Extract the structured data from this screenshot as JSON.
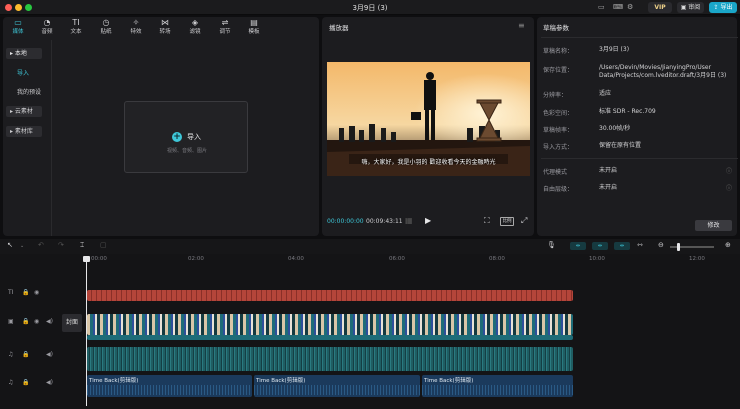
{
  "window": {
    "title": "3月9日 (3)"
  },
  "topbar": {
    "vip_label": "VIP",
    "review_label": "审阅",
    "export_label": "导出"
  },
  "toolbar": {
    "items": [
      {
        "icon": "media-icon",
        "label": "媒体"
      },
      {
        "icon": "audio-icon",
        "label": "音频"
      },
      {
        "icon": "text-icon",
        "label": "文本"
      },
      {
        "icon": "sticker-icon",
        "label": "贴纸"
      },
      {
        "icon": "effects-icon",
        "label": "特效"
      },
      {
        "icon": "transition-icon",
        "label": "转场"
      },
      {
        "icon": "filter-icon",
        "label": "滤镜"
      },
      {
        "icon": "adjust-icon",
        "label": "调节"
      },
      {
        "icon": "template-icon",
        "label": "模板"
      }
    ]
  },
  "sidebar": {
    "items": [
      {
        "label": "▸ 本地"
      },
      {
        "label": "导入"
      },
      {
        "label": "我的预设"
      },
      {
        "label": "▸ 云素材"
      },
      {
        "label": "▸ 素材库"
      }
    ]
  },
  "media": {
    "import_label": "导入",
    "import_hint": "视频、音频、图片"
  },
  "player": {
    "title": "播放器",
    "subtitle": "嗨，大家好，我是小羽的 歡迎收看今天的金融時光",
    "current_time": "00:00:00:00",
    "total_time": "00:09:43:11",
    "ratio_label": "比例"
  },
  "draft": {
    "title": "草稿参数",
    "rows": [
      {
        "label": "草稿名称：",
        "value": "3月9日 (3)"
      },
      {
        "label": "保存位置：",
        "value": "/Users/Devin/Movies/JianyingPro/User Data/Projects/com.lveditor.draft/3月9日 (3)"
      },
      {
        "label": "分辨率：",
        "value": "适应"
      },
      {
        "label": "色彩空间：",
        "value": "标准 SDR - Rec.709"
      },
      {
        "label": "草稿帧率：",
        "value": "30.00帧/秒"
      },
      {
        "label": "导入方式：",
        "value": "保留在原有位置"
      },
      {
        "label": "代理模式",
        "value": "未开启"
      },
      {
        "label": "自由层级：",
        "value": "未开启"
      }
    ],
    "edit_label": "修改"
  },
  "timeline": {
    "ruler": [
      "00:00",
      "02:00",
      "04:00",
      "06:00",
      "08:00",
      "10:00",
      "12:00"
    ],
    "cover_label": "封面",
    "audio_clips": [
      "Time Back(剪辑版)",
      "Time Back(剪辑版)",
      "Time Back(剪辑版)"
    ]
  },
  "colors": {
    "accent": "#3ec7d8",
    "export_bg": "#1aa6c8",
    "text_track": "#b4453a",
    "video_track": "#1e6c78",
    "audio_track": "#1b3a5c"
  }
}
